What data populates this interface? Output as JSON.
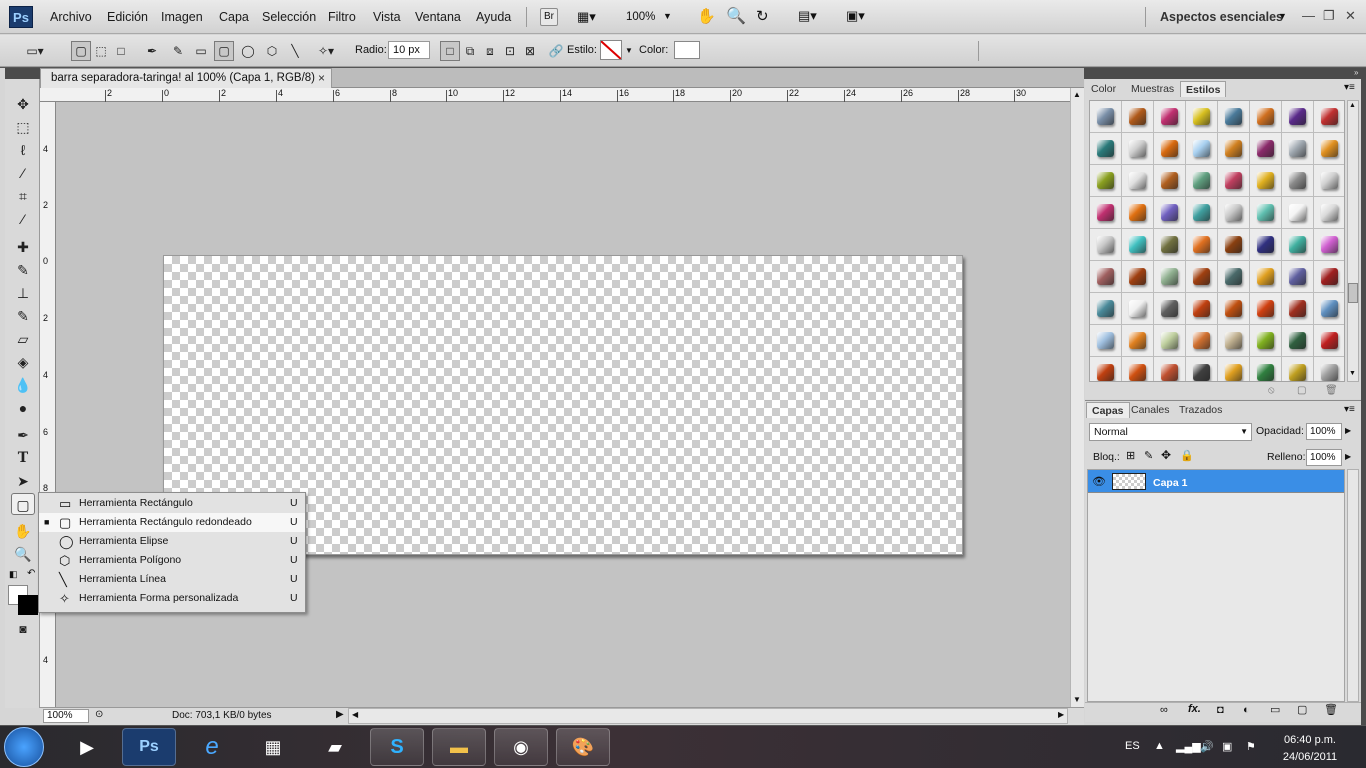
{
  "app": {
    "logo": "Ps"
  },
  "menu": [
    "Archivo",
    "Edición",
    "Imagen",
    "Capa",
    "Selección",
    "Filtro",
    "Vista",
    "Ventana",
    "Ayuda"
  ],
  "menubar": {
    "br_label": "Br",
    "zoom": "100%",
    "workspace": "Aspectos esenciales"
  },
  "options": {
    "radio_label": "Radio:",
    "radio_value": "10 px",
    "estilo_label": "Estilo:",
    "color_label": "Color:",
    "color_value": "#ffffff"
  },
  "document": {
    "tab_title": "barra separadora-taringa! al 100% (Capa 1, RGB/8)",
    "tab_close": "×"
  },
  "ruler_h": [
    "2",
    "0",
    "2",
    "4",
    "6",
    "8",
    "10",
    "12",
    "14",
    "16",
    "18",
    "20",
    "22",
    "24",
    "26",
    "28",
    "30"
  ],
  "ruler_v": [
    "4",
    "2",
    "0",
    "2",
    "4",
    "6",
    "8",
    "1",
    "1",
    "4"
  ],
  "status": {
    "zoom": "100%",
    "doc_info": "Doc: 703,1 KB/0 bytes"
  },
  "flyout": [
    {
      "label": "Herramienta Rectángulo",
      "key": "U",
      "selected": false
    },
    {
      "label": "Herramienta Rectángulo redondeado",
      "key": "U",
      "selected": true
    },
    {
      "label": "Herramienta Elipse",
      "key": "U",
      "selected": false
    },
    {
      "label": "Herramienta Polígono",
      "key": "U",
      "selected": false
    },
    {
      "label": "Herramienta Línea",
      "key": "U",
      "selected": false
    },
    {
      "label": "Herramienta Forma personalizada",
      "key": "U",
      "selected": false
    }
  ],
  "style_panel": {
    "tabs": [
      "Color",
      "Muestras",
      "Estilos"
    ],
    "active_tab": "Estilos"
  },
  "style_colors": [
    "#7a8fa8",
    "#b05a1a",
    "#c03070",
    "#d8c020",
    "#4a7a9a",
    "#d07020",
    "#5a2a8a",
    "#c03030",
    "#2a7a7a",
    "#cfcfcf",
    "#d86a10",
    "#a8d0f0",
    "#d08020",
    "#8a2a6a",
    "#a0a8b0",
    "#e09020",
    "#8aa020",
    "#e0e0e0",
    "#b06020",
    "#60a080",
    "#c04060",
    "#e0b020",
    "#8a8a8a",
    "#d0d0d0",
    "#c03070",
    "#e07010",
    "#7060c0",
    "#40a0a0",
    "#c8c8c8",
    "#60c0b0",
    "#f4f4f4",
    "#dadada",
    "#c8c8c8",
    "#40c0c0",
    "#707040",
    "#e07020",
    "#8a4010",
    "#303080",
    "#40b0a0",
    "#d060d0",
    "#a06060",
    "#a04010",
    "#90b090",
    "#a04010",
    "#4a6a6a",
    "#e0a020",
    "#6060a0",
    "#a02020",
    "#4a8a9a",
    "#f0f0f0",
    "#606060",
    "#c04010",
    "#c05010",
    "#d04010",
    "#a03020",
    "#6090c0",
    "#a0c0e0",
    "#e08020",
    "#c0d0a0",
    "#d07030",
    "#c0b090",
    "#80b020",
    "#306040",
    "#c02020",
    "#c04010",
    "#d05010",
    "#c05030",
    "#404040",
    "#e0a020",
    "#308040",
    "#c0a020",
    "#a0a0a0"
  ],
  "layers_panel": {
    "tabs": [
      "Capas",
      "Canales",
      "Trazados"
    ],
    "active_tab": "Capas",
    "blend_mode": "Normal",
    "opacity_label": "Opacidad:",
    "opacity": "100%",
    "lock_label": "Bloq.:",
    "fill_label": "Relleno:",
    "fill": "100%",
    "layers": [
      {
        "name": "Capa 1",
        "visible": true,
        "selected": true
      }
    ]
  },
  "taskbar": {
    "lang": "ES",
    "time": "06:40 p.m.",
    "date": "24/06/2011",
    "apps": [
      "media-player",
      "photoshop",
      "internet-explorer",
      "calculator",
      "notepad",
      "skype",
      "file-explorer",
      "chrome",
      "paint"
    ]
  }
}
